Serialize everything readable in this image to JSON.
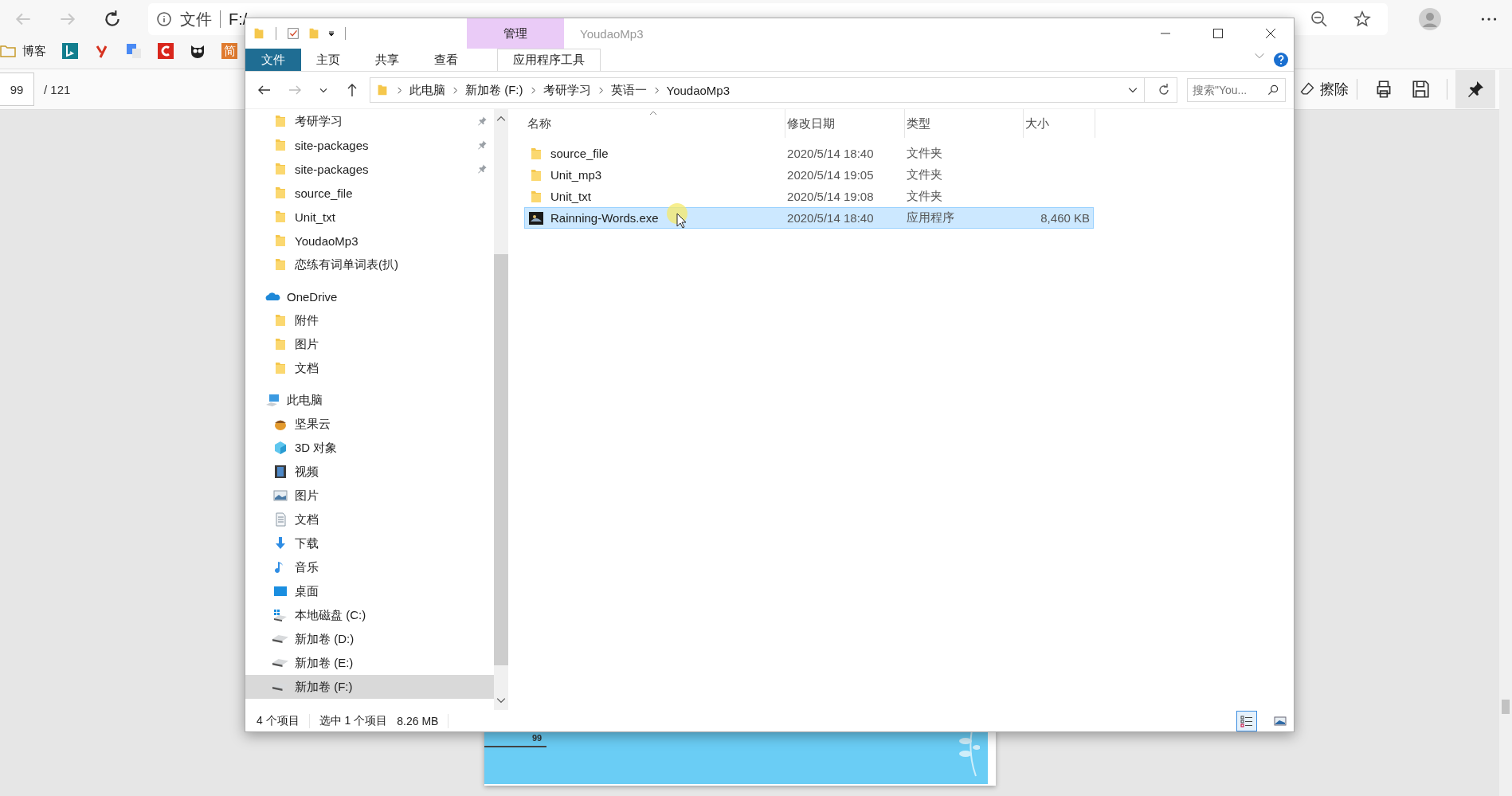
{
  "browser": {
    "address_label": "文件",
    "address": "F:/",
    "bookmarks": [
      {
        "kind": "folder",
        "label": "博客"
      },
      {
        "kind": "bing"
      },
      {
        "kind": "y"
      },
      {
        "kind": "translate"
      },
      {
        "kind": "c"
      },
      {
        "kind": "owl"
      },
      {
        "kind": "tile",
        "label": "简"
      }
    ]
  },
  "pdf_toolbar": {
    "page": "99",
    "total": "/ 121",
    "erase": "擦除"
  },
  "pdf_page": {
    "page_number": "99"
  },
  "explorer": {
    "context_group": "管理",
    "title": "YoudaoMp3",
    "ribbon_tabs": [
      {
        "label": "文件",
        "kind": "file",
        "selected": false
      },
      {
        "label": "主页",
        "kind": "normal",
        "selected": false
      },
      {
        "label": "共享",
        "kind": "normal",
        "selected": false
      },
      {
        "label": "查看",
        "kind": "normal",
        "selected": false
      },
      {
        "label": "应用程序工具",
        "kind": "context",
        "selected": true
      }
    ],
    "breadcrumbs": [
      "此电脑",
      "新加卷 (F:)",
      "考研学习",
      "英语一",
      "YoudaoMp3"
    ],
    "search": {
      "placeholder": "搜索\"You..."
    },
    "quick_access": [
      {
        "label": "考研学习",
        "kind": "folder",
        "pinned": true,
        "selected": false
      },
      {
        "label": "site-packages",
        "kind": "folder",
        "pinned": true,
        "selected": false
      },
      {
        "label": "site-packages",
        "kind": "folder",
        "pinned": true,
        "selected": false
      },
      {
        "label": "source_file",
        "kind": "folder",
        "pinned": false,
        "selected": false
      },
      {
        "label": "Unit_txt",
        "kind": "folder",
        "pinned": false,
        "selected": false
      },
      {
        "label": "YoudaoMp3",
        "kind": "folder",
        "pinned": false,
        "selected": false
      },
      {
        "label": "恋练有词单词表(扒)",
        "kind": "folder",
        "pinned": false,
        "selected": false
      }
    ],
    "nav_groups": [
      {
        "label": "OneDrive",
        "kind": "onedrive",
        "selected": false,
        "children": [
          {
            "label": "附件",
            "kind": "folder",
            "selected": false
          },
          {
            "label": "图片",
            "kind": "folder",
            "selected": false
          },
          {
            "label": "文档",
            "kind": "folder",
            "selected": false
          }
        ]
      },
      {
        "label": "此电脑",
        "kind": "pc",
        "selected": false,
        "children": [
          {
            "label": "坚果云",
            "kind": "nutstore",
            "selected": false
          },
          {
            "label": "3D 对象",
            "kind": "objects",
            "selected": false
          },
          {
            "label": "视频",
            "kind": "video",
            "selected": false
          },
          {
            "label": "图片",
            "kind": "pictures",
            "selected": false
          },
          {
            "label": "文档",
            "kind": "documents",
            "selected": false
          },
          {
            "label": "下载",
            "kind": "downloads",
            "selected": false
          },
          {
            "label": "音乐",
            "kind": "music",
            "selected": false
          },
          {
            "label": "桌面",
            "kind": "desktop",
            "selected": false
          },
          {
            "label": "本地磁盘 (C:)",
            "kind": "drive_c",
            "selected": false
          },
          {
            "label": "新加卷 (D:)",
            "kind": "drive",
            "selected": false
          },
          {
            "label": "新加卷 (E:)",
            "kind": "drive",
            "selected": false
          },
          {
            "label": "新加卷 (F:)",
            "kind": "drive",
            "selected": true
          }
        ]
      }
    ],
    "columns": [
      {
        "label": "名称",
        "sorted": true
      },
      {
        "label": "修改日期",
        "sorted": false
      },
      {
        "label": "类型",
        "sorted": false
      },
      {
        "label": "大小",
        "sorted": false
      }
    ],
    "files": [
      {
        "name": "source_file",
        "date": "2020/5/14 18:40",
        "type": "文件夹",
        "kind": "folder",
        "selected": false
      },
      {
        "name": "Unit_mp3",
        "date": "2020/5/14 19:05",
        "type": "文件夹",
        "kind": "folder",
        "selected": false
      },
      {
        "name": "Unit_txt",
        "date": "2020/5/14 19:08",
        "type": "文件夹",
        "kind": "folder",
        "selected": false
      },
      {
        "name": "Rainning-Words.exe",
        "date": "2020/5/14 18:40",
        "type": "应用程序",
        "size": "8,460 KB",
        "kind": "exe",
        "selected": true
      }
    ],
    "status": {
      "count": "4 个项目",
      "selection": "选中 1 个项目",
      "size": "8.26 MB"
    },
    "view_buttons": [
      {
        "kind": "details",
        "selected": true
      },
      {
        "kind": "tiles",
        "selected": false
      }
    ]
  }
}
